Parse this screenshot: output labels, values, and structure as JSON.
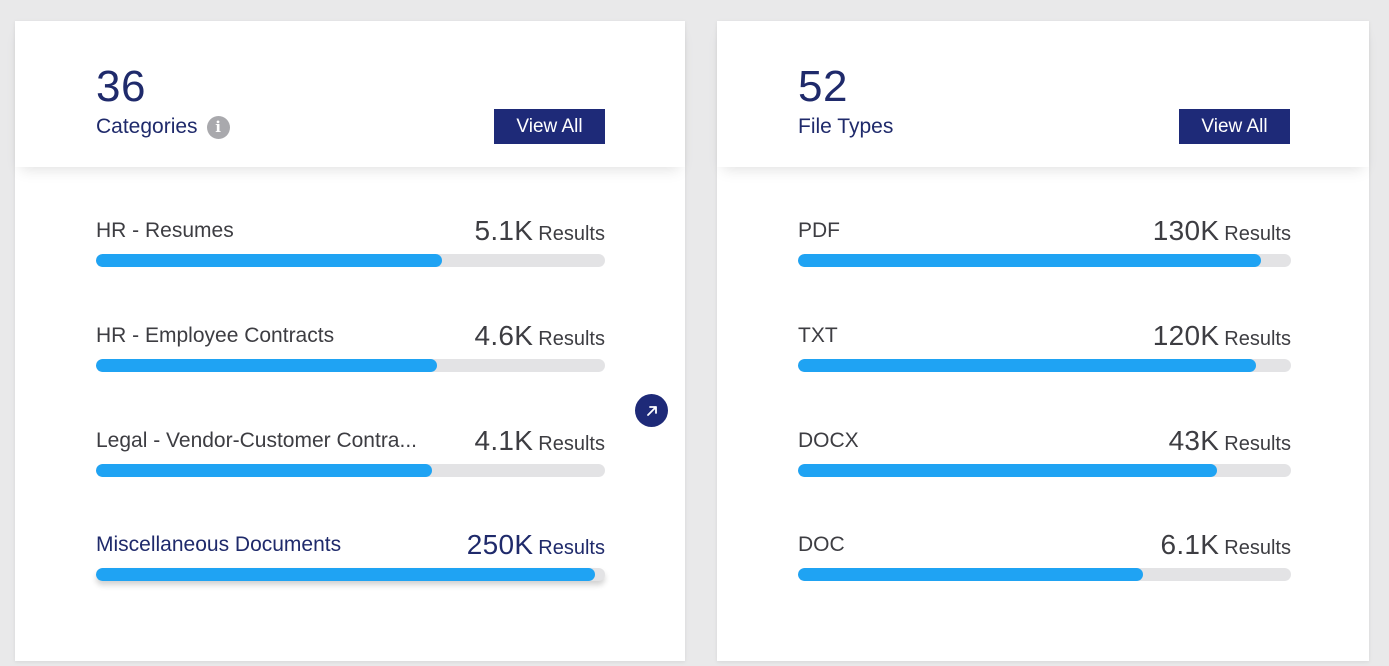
{
  "categories": {
    "count": "36",
    "label": "Categories",
    "info_icon": "info-icon",
    "view_all_label": "View All",
    "items": [
      {
        "label": "HR - Resumes",
        "value": "5.1K",
        "unit": "Results",
        "fill_pct": 68
      },
      {
        "label": "HR - Employee Contracts",
        "value": "4.6K",
        "unit": "Results",
        "fill_pct": 67
      },
      {
        "label": "Legal - Vendor-Customer Contra...",
        "value": "4.1K",
        "unit": "Results",
        "fill_pct": 66
      },
      {
        "label": "Miscellaneous Documents",
        "value": "250K",
        "unit": "Results",
        "fill_pct": 98
      }
    ],
    "action_icon": "arrow-up-right-icon"
  },
  "file_types": {
    "count": "52",
    "label": "File Types",
    "view_all_label": "View All",
    "items": [
      {
        "label": "PDF",
        "value": "130K",
        "unit": "Results",
        "fill_pct": 94
      },
      {
        "label": "TXT",
        "value": "120K",
        "unit": "Results",
        "fill_pct": 93
      },
      {
        "label": "DOCX",
        "value": "43K",
        "unit": "Results",
        "fill_pct": 85
      },
      {
        "label": "DOC",
        "value": "6.1K",
        "unit": "Results",
        "fill_pct": 70
      }
    ]
  },
  "colors": {
    "accent": "#1e2a78",
    "bar_fill": "#1fa3f3",
    "bar_track": "#e3e3e5"
  }
}
